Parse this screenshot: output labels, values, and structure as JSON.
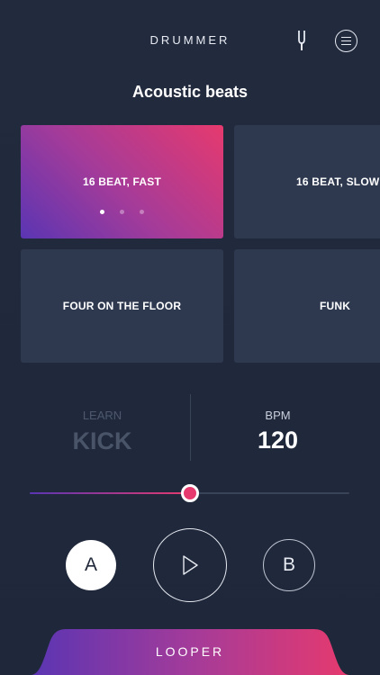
{
  "header": {
    "app_title": "DRUMMER",
    "tuner_icon": "tuning-fork-icon",
    "menu_icon": "menu-icon"
  },
  "category": {
    "title": "Acoustic beats"
  },
  "beats": [
    {
      "label": "16 BEAT, FAST",
      "selected": true
    },
    {
      "label": "16 BEAT, SLOW",
      "selected": false
    },
    {
      "label": "FOUR ON THE FLOOR",
      "selected": false
    },
    {
      "label": "FUNK",
      "selected": false
    }
  ],
  "pager": {
    "pages": 3,
    "current": 1
  },
  "learn": {
    "label": "LEARN",
    "value": "KICK"
  },
  "tempo": {
    "label": "BPM",
    "value": "120",
    "slider_fraction": 0.5
  },
  "controls": {
    "a_label": "A",
    "play_icon": "play-icon",
    "b_label": "B"
  },
  "looper": {
    "label": "LOOPER"
  },
  "colors": {
    "background": "#212b40",
    "card": "#2e3950",
    "accent_start": "#5a35b3",
    "accent_end": "#e63a6e"
  }
}
